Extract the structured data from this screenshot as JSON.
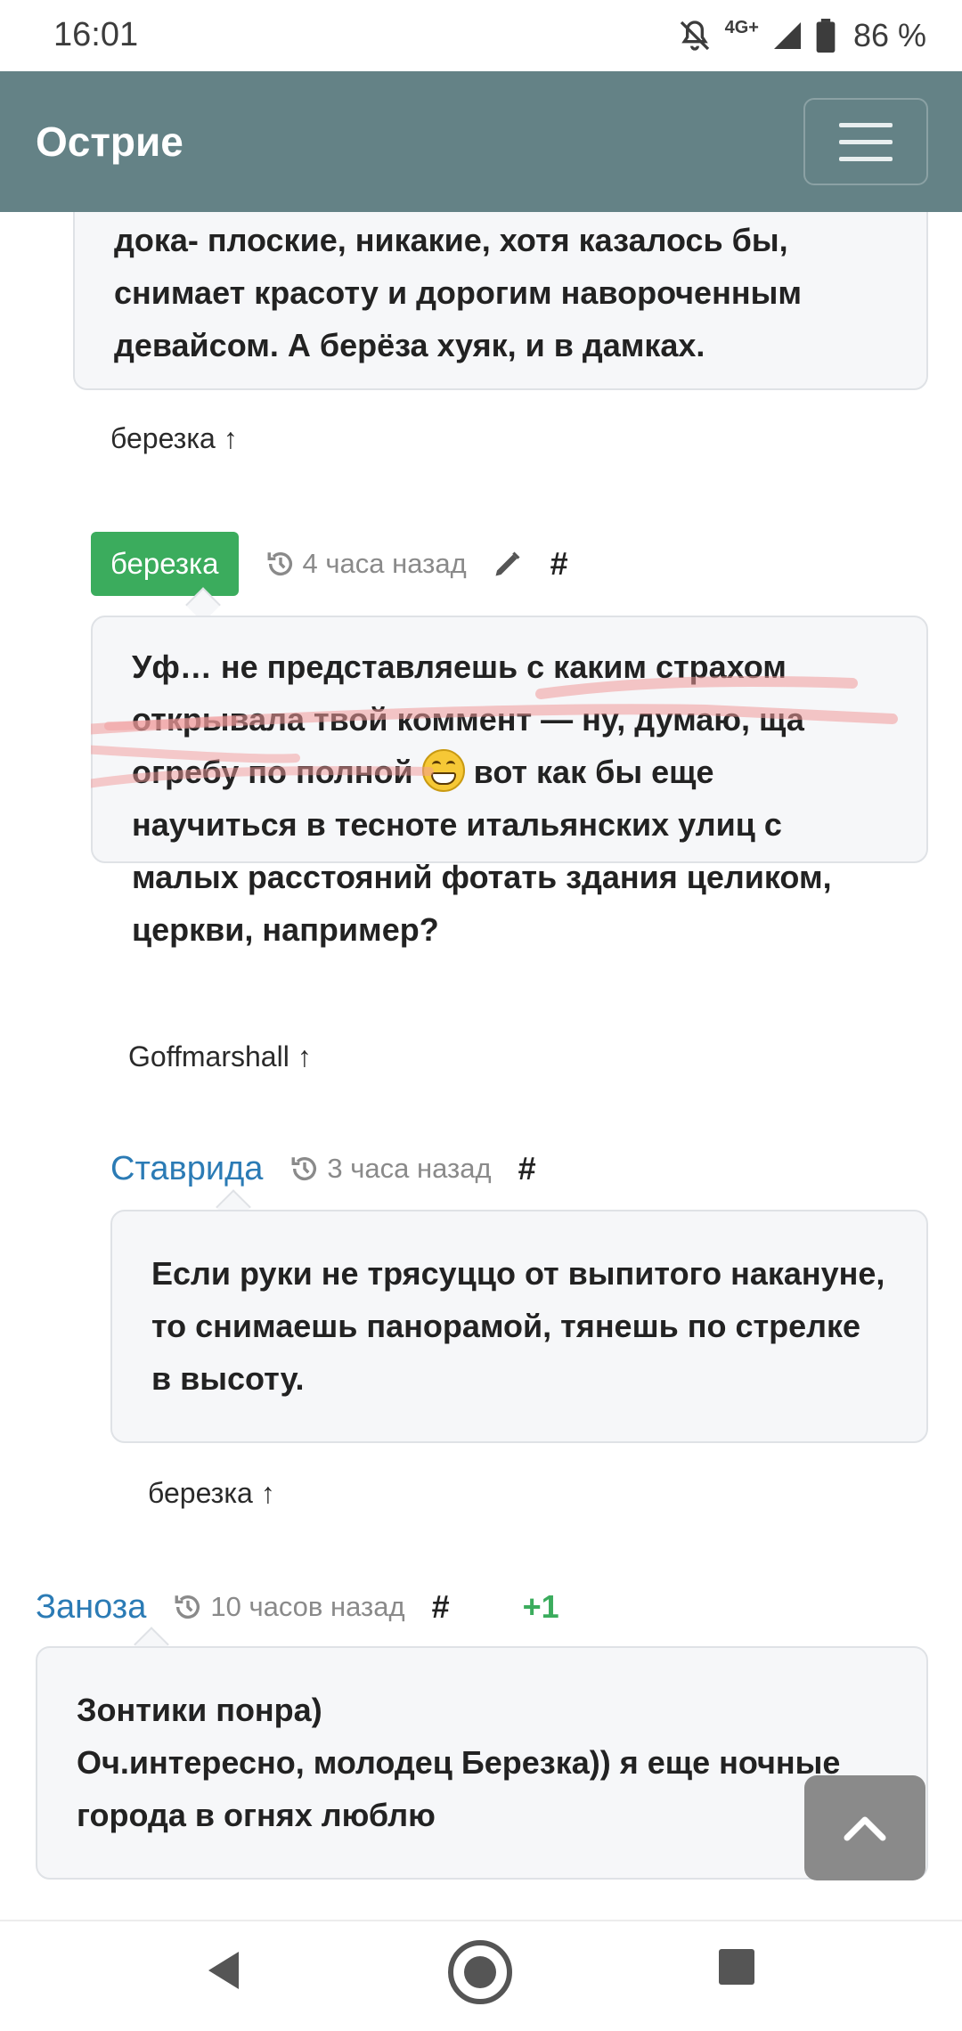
{
  "status_bar": {
    "time": "16:01",
    "network": "4G+",
    "battery": "86 %"
  },
  "site": {
    "brand": "Острие"
  },
  "comments": [
    {
      "id": "partial",
      "text": "дока- плоские, никакие, хотя казалось бы, снимает красоту и дорогим навороченным девайсом. А берёза хуяк, и в дамках.",
      "reply_to": "березка ↑"
    },
    {
      "id": "berezka",
      "author": "березка",
      "time": "4 часа назад",
      "hash": "#",
      "text_before_emoji": "Уф… не представляешь с каким страхом открывала твой коммент — ну, думаю, ща огребу по полной",
      "text_after_emoji": " вот как бы еще научиться в тесноте итальянских улиц с малых расстояний фотать здания целиком, церкви, например?",
      "reply_to": "Goffmarshall ↑"
    },
    {
      "id": "stavrida",
      "author": "Ставрида",
      "time": "3 часа назад",
      "hash": "#",
      "text": "Если руки не трясуццо от выпитого накануне, то снимаешь панорамой, тянешь по стрелке в высоту.",
      "reply_to": "березка ↑"
    },
    {
      "id": "zanoza",
      "author": "Заноза",
      "time": "10 часов назад",
      "hash": "#",
      "rating": "+1",
      "line1": "Зонтики понра)",
      "line2": "Оч.интересно, молодец Березка)) я еще ночные города в огнях люблю"
    }
  ],
  "icons": {
    "history": "history-icon",
    "edit": "pencil-icon",
    "menu": "hamburger-menu-icon",
    "scroll_top": "chevron-up-icon"
  },
  "colors": {
    "navbar": "#648286",
    "author_badge": "#3bac5d",
    "author_link": "#2b7bb5",
    "rating": "#3bac5d"
  }
}
